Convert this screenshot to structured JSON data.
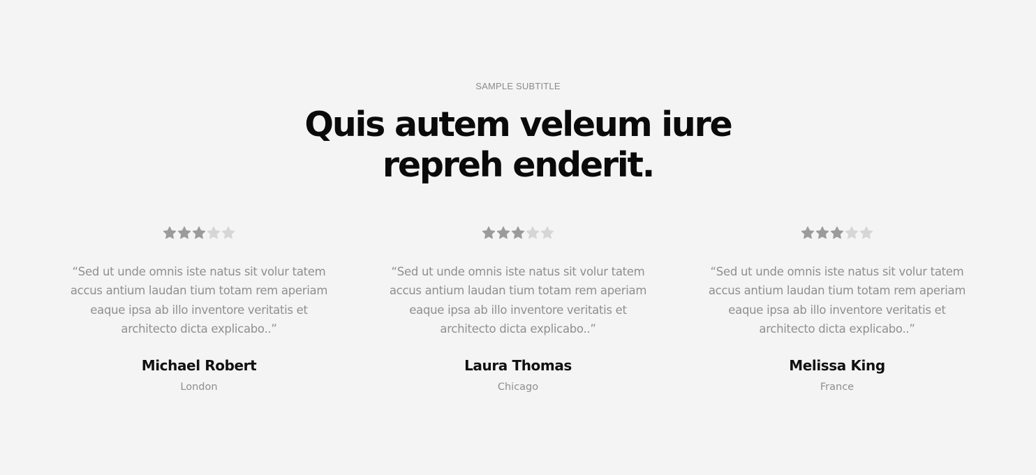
{
  "section": {
    "subtitle": "SAMPLE SUBTITLE",
    "headline_line1": "Quis autem veleum iure",
    "headline_line2": "repreh enderit."
  },
  "colors": {
    "star_filled": "#9b9b9b",
    "star_empty": "#d6d6d6",
    "background": "#f4f4f4"
  },
  "testimonials": [
    {
      "rating": 3,
      "max_rating": 5,
      "quote": "“Sed ut unde omnis iste natus sit volur tatem accus antium laudan tium totam rem aperiam eaque ipsa ab illo inventore veritatis et architecto dicta explicabo..”",
      "name": "Michael Robert",
      "location": "London"
    },
    {
      "rating": 3,
      "max_rating": 5,
      "quote": "“Sed ut unde omnis iste natus sit volur tatem accus antium laudan tium totam rem aperiam eaque ipsa ab illo inventore veritatis et architecto dicta explicabo..”",
      "name": "Laura Thomas",
      "location": "Chicago"
    },
    {
      "rating": 3,
      "max_rating": 5,
      "quote": "“Sed ut unde omnis iste natus sit volur tatem accus antium laudan tium totam rem aperiam eaque ipsa ab illo inventore veritatis et architecto dicta explicabo..”",
      "name": "Melissa King",
      "location": "France"
    }
  ]
}
